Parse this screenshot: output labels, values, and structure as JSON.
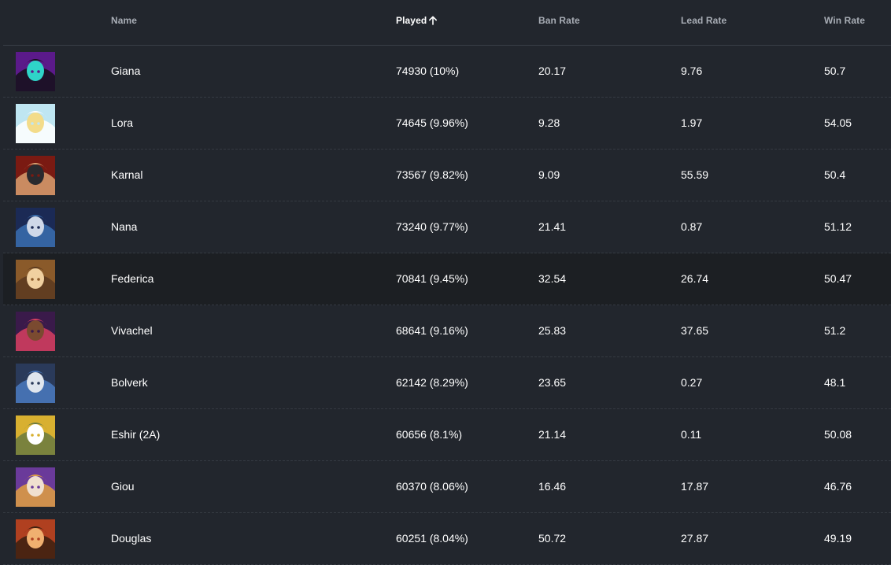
{
  "columns": {
    "name": "Name",
    "played": "Played",
    "ban_rate": "Ban Rate",
    "lead_rate": "Lead Rate",
    "win_rate": "Win Rate"
  },
  "sort": {
    "column": "played",
    "icon": "arrow-up-icon"
  },
  "rows": [
    {
      "name": "Giana",
      "played": "74930 (10%)",
      "ban_rate": "20.17",
      "lead_rate": "9.76",
      "win_rate": "50.7",
      "colors": [
        "#5b1a8a",
        "#2fd4c8",
        "#141018"
      ]
    },
    {
      "name": "Lora",
      "played": "74645 (9.96%)",
      "ban_rate": "9.28",
      "lead_rate": "1.97",
      "win_rate": "54.05",
      "colors": [
        "#bfe6f2",
        "#f3dc8a",
        "#ffffff"
      ]
    },
    {
      "name": "Karnal",
      "played": "73567 (9.82%)",
      "ban_rate": "9.09",
      "lead_rate": "55.59",
      "win_rate": "50.4",
      "colors": [
        "#7a1a12",
        "#2a2a2e",
        "#d8a070"
      ]
    },
    {
      "name": "Nana",
      "played": "73240 (9.77%)",
      "ban_rate": "21.41",
      "lead_rate": "0.87",
      "win_rate": "51.12",
      "colors": [
        "#1b2a55",
        "#cfd8e8",
        "#3a6fb0"
      ]
    },
    {
      "name": "Federica",
      "played": "70841 (9.45%)",
      "ban_rate": "32.54",
      "lead_rate": "26.74",
      "win_rate": "50.47",
      "colors": [
        "#8a5a2a",
        "#f0d0a0",
        "#5a3a20"
      ]
    },
    {
      "name": "Vivachel",
      "played": "68641 (9.16%)",
      "ban_rate": "25.83",
      "lead_rate": "37.65",
      "win_rate": "51.2",
      "colors": [
        "#3a1a4a",
        "#7a4a30",
        "#d84060"
      ]
    },
    {
      "name": "Bolverk",
      "played": "62142 (8.29%)",
      "ban_rate": "23.65",
      "lead_rate": "0.27",
      "win_rate": "48.1",
      "colors": [
        "#2a3a5a",
        "#e0e6ee",
        "#4a7ac0"
      ]
    },
    {
      "name": "Eshir (2A)",
      "played": "60656 (8.1%)",
      "ban_rate": "21.14",
      "lead_rate": "0.11",
      "win_rate": "50.08",
      "colors": [
        "#d8b030",
        "#ffffff",
        "#6a7a40"
      ]
    },
    {
      "name": "Giou",
      "played": "60370 (8.06%)",
      "ban_rate": "16.46",
      "lead_rate": "17.87",
      "win_rate": "46.76",
      "colors": [
        "#6a3a9a",
        "#f0e0d0",
        "#e0a040"
      ]
    },
    {
      "name": "Douglas",
      "played": "60251 (8.04%)",
      "ban_rate": "50.72",
      "lead_rate": "27.87",
      "win_rate": "49.19",
      "colors": [
        "#b04020",
        "#f0b070",
        "#3a2010"
      ]
    }
  ],
  "hovered_row": 4
}
